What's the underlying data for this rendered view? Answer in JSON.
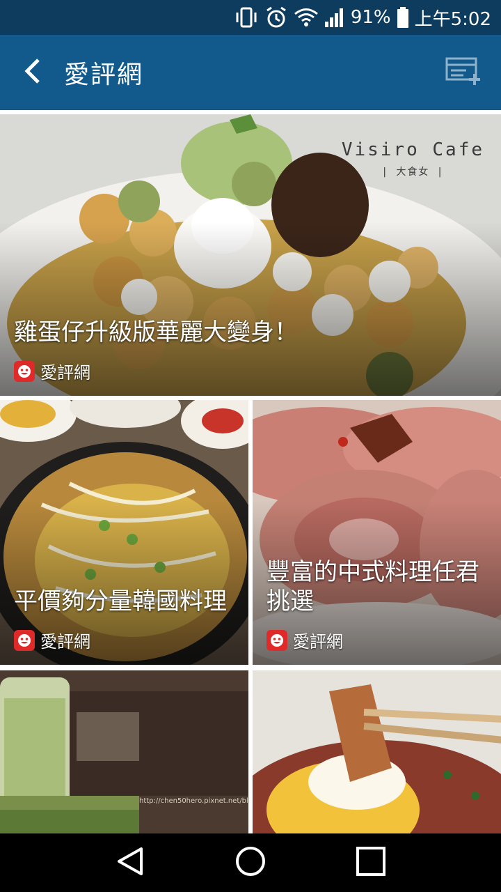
{
  "status_bar": {
    "battery_percent": "91%",
    "time": "上午5:02",
    "icons": [
      "vibrate-icon",
      "alarm-icon",
      "wifi-icon",
      "signal-icon",
      "battery-icon"
    ]
  },
  "app_bar": {
    "title": "愛評網",
    "back_icon": "back-arrow-icon",
    "action_icon": "add-to-list-icon"
  },
  "feed": {
    "cards": [
      {
        "title": "雞蛋仔升級版華麗大變身！",
        "source": "愛評網",
        "watermark": "Visiro Cafe",
        "watermark_sub": "| 大食女 |"
      },
      {
        "title": "平價夠分量韓國料理",
        "source": "愛評網"
      },
      {
        "title": "豐富的中式料理任君挑選",
        "source": "愛評網"
      },
      {
        "title": "",
        "source": ""
      },
      {
        "title": "",
        "source": ""
      }
    ]
  },
  "colors": {
    "status_bar": "#0d3c5e",
    "app_bar": "#135a8c",
    "source_logo": "#e02a2a"
  },
  "nav_bar": {
    "icons": [
      "back-triangle-icon",
      "home-circle-icon",
      "recents-square-icon"
    ]
  }
}
